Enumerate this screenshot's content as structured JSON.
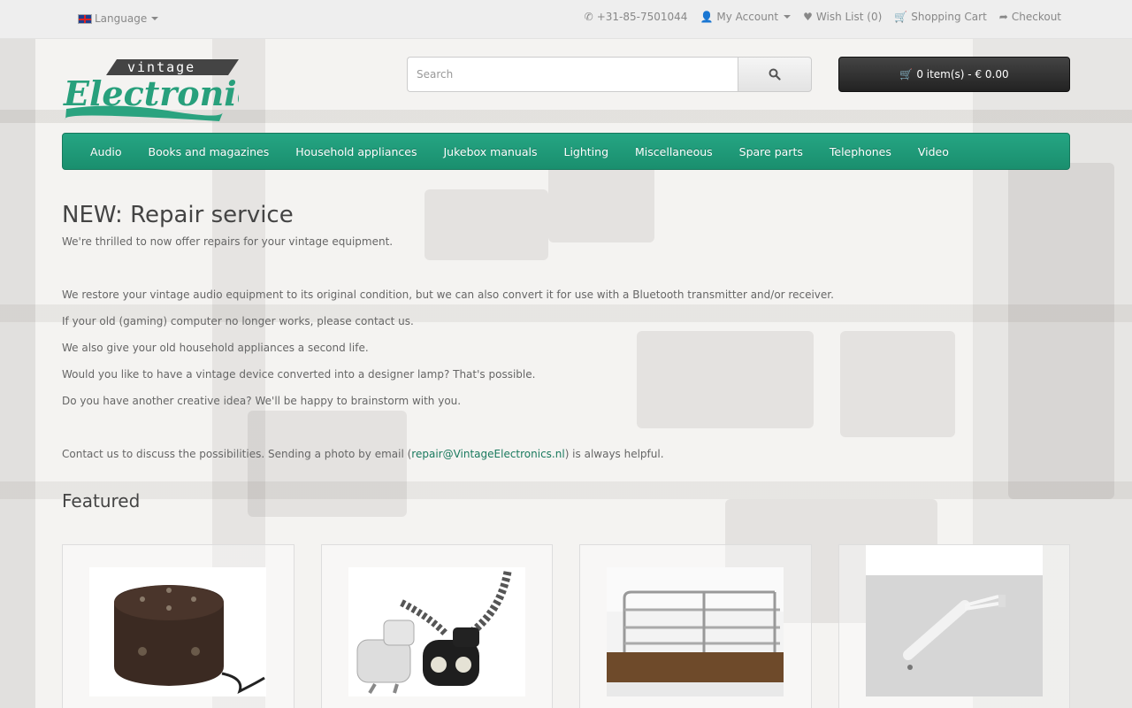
{
  "topbar": {
    "language_label": "Language",
    "phone": "+31-85-7501044",
    "my_account": "My Account",
    "wish_list": "Wish List (0)",
    "shopping_cart": "Shopping Cart",
    "checkout": "Checkout"
  },
  "header": {
    "logo_top": "vintage",
    "logo_main": "Electronics",
    "search_placeholder": "Search",
    "cart_summary": "0 item(s) - € 0.00"
  },
  "menu": {
    "items": [
      "Audio",
      "Books and magazines",
      "Household appliances",
      "Jukebox manuals",
      "Lighting",
      "Miscellaneous",
      "Spare parts",
      "Telephones",
      "Video"
    ]
  },
  "content": {
    "title": "NEW: Repair service",
    "intro": "We're thrilled to now offer repairs for your vintage equipment.",
    "lines": [
      "We restore your vintage audio equipment to its original condition, but we can also convert it for use with a Bluetooth transmitter and/or receiver.",
      "If your old (gaming) computer no longer works, please contact us.",
      "We also give your old household appliances a second life.",
      "Would you like to have a vintage device converted into a designer lamp? That's possible.",
      "Do you have another creative idea? We'll be happy to brainstorm with you."
    ],
    "contact_before": "Contact us to discuss the possibilities. Sending a photo by email (",
    "contact_email": "repair@VintageElectronics.nl",
    "contact_after": ") is always helpful.",
    "featured_title": "Featured"
  },
  "colors": {
    "menu_green": "#1f9a78",
    "link_green": "#1a7a5e",
    "cart_dark": "#333333"
  },
  "icons": [
    "flag-uk-icon",
    "phone-icon",
    "user-icon",
    "heart-icon",
    "cart-icon",
    "share-icon",
    "search-icon"
  ]
}
